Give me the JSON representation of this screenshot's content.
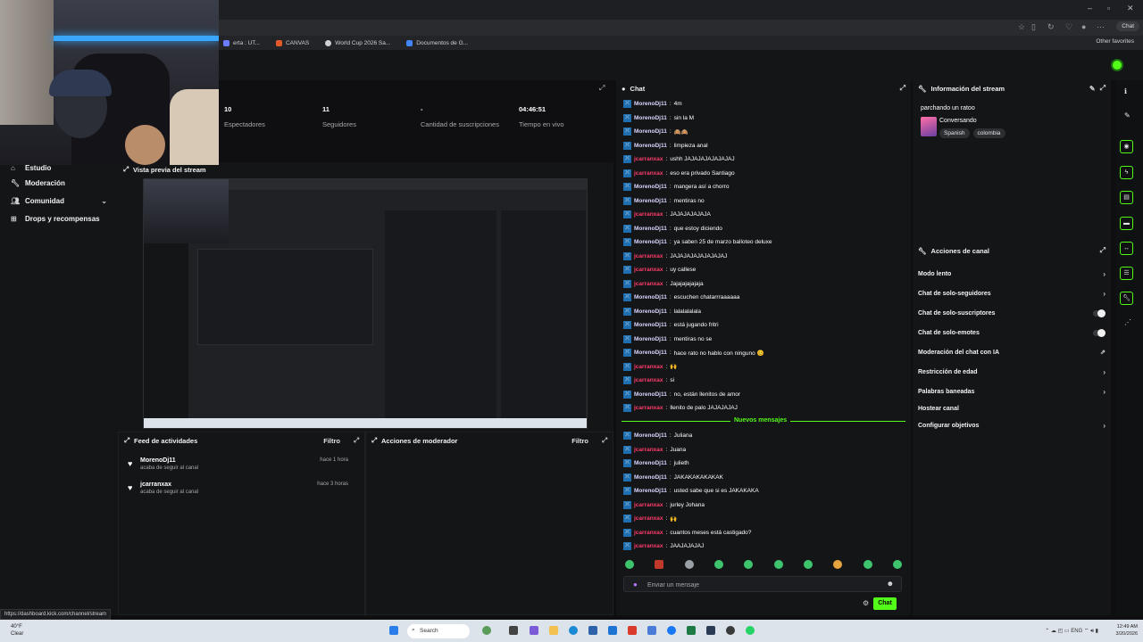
{
  "browser": {
    "bookmarks": [
      {
        "label": "erta : UT..."
      },
      {
        "label": "CANVAS"
      },
      {
        "label": "World Cup 2026 Sa..."
      },
      {
        "label": "Documentos de G..."
      }
    ],
    "other_favorites": "Other favorites",
    "chat_button": "Chat"
  },
  "sidebar": {
    "items": [
      {
        "label": "Estudio",
        "icon": "home-icon"
      },
      {
        "label": "Moderación",
        "icon": "wrench-icon"
      },
      {
        "label": "Comunidad",
        "icon": "people-icon"
      },
      {
        "label": "Drops y recompensas",
        "icon": "gift-icon"
      }
    ]
  },
  "stats": [
    {
      "value": "10",
      "label": "Espectadores"
    },
    {
      "value": "11",
      "label": "Seguidores"
    },
    {
      "value": "-",
      "label": "Cantidad de suscripciones"
    },
    {
      "value": "04:46:51",
      "label": "Tiempo en vivo"
    }
  ],
  "preview": {
    "title": "Vista previa del stream"
  },
  "activity": {
    "title": "Feed de actividades",
    "filter": "Filtro",
    "items": [
      {
        "name": "MorenoDj11",
        "sub": "acaba de seguir al canal",
        "time": "hace 1 hora"
      },
      {
        "name": "jcarranxax",
        "sub": "acaba de seguir al canal",
        "time": "hace 3 horas"
      }
    ]
  },
  "modactions": {
    "title": "Acciones de moderador",
    "filter": "Filtro"
  },
  "chat": {
    "title": "Chat",
    "messages": [
      {
        "user": "MorenoDj11",
        "kind": "a",
        "text": "4m"
      },
      {
        "user": "MorenoDj11",
        "kind": "a",
        "text": "sin la M"
      },
      {
        "user": "MorenoDj11",
        "kind": "a",
        "text": "🙈🙈"
      },
      {
        "user": "MorenoDj11",
        "kind": "a",
        "text": "limpieza anal"
      },
      {
        "user": "jcarranxax",
        "kind": "b",
        "text": "ushh JAJAJAJAJAJAJAJ"
      },
      {
        "user": "jcarranxax",
        "kind": "b",
        "text": "eso era privado Santiago"
      },
      {
        "user": "MorenoDj11",
        "kind": "a",
        "text": "mangera así a chorro"
      },
      {
        "user": "MorenoDj11",
        "kind": "a",
        "text": "mentiras no"
      },
      {
        "user": "jcarranxax",
        "kind": "b",
        "text": "JAJAJAJAJAJA"
      },
      {
        "user": "MorenoDj11",
        "kind": "a",
        "text": "que estoy diciendo"
      },
      {
        "user": "MorenoDj11",
        "kind": "a",
        "text": "ya saben 25 de marzo balloteo deluxe"
      },
      {
        "user": "jcarranxax",
        "kind": "b",
        "text": "JAJAJAJAJAJAJAJAJ"
      },
      {
        "user": "jcarranxax",
        "kind": "b",
        "text": "uy callese"
      },
      {
        "user": "jcarranxax",
        "kind": "b",
        "text": "Jajajajajajaja"
      },
      {
        "user": "MorenoDj11",
        "kind": "a",
        "text": "escuchen chatarrraaaaaa"
      },
      {
        "user": "MorenoDj11",
        "kind": "a",
        "text": "lalalalalala"
      },
      {
        "user": "MorenoDj11",
        "kind": "a",
        "text": "está jugando fritri"
      },
      {
        "user": "MorenoDj11",
        "kind": "a",
        "text": "mentiras no se"
      },
      {
        "user": "MorenoDj11",
        "kind": "a",
        "text": "hace rato no hablo con ninguno 😊"
      },
      {
        "user": "jcarranxax",
        "kind": "b",
        "text": "🙌"
      },
      {
        "user": "jcarranxax",
        "kind": "b",
        "text": "si"
      },
      {
        "user": "MorenoDj11",
        "kind": "a",
        "text": "no, están llenitos de amor"
      },
      {
        "user": "jcarranxax",
        "kind": "b",
        "text": "llenito de palo JAJAJAJAJ"
      }
    ],
    "new_messages_label": "Nuevos mensajes",
    "new_messages": [
      {
        "user": "MorenoDj11",
        "kind": "a",
        "text": "Juliana"
      },
      {
        "user": "jcarranxax",
        "kind": "b",
        "text": "Juana"
      },
      {
        "user": "MorenoDj11",
        "kind": "a",
        "text": "julieth"
      },
      {
        "user": "MorenoDj11",
        "kind": "a",
        "text": "JAKAKAKAKAKAK"
      },
      {
        "user": "MorenoDj11",
        "kind": "a",
        "text": "usted sabe que si es JAKAKAKA"
      },
      {
        "user": "jcarranxax",
        "kind": "b",
        "text": "jurley Johana"
      },
      {
        "user": "jcarranxax",
        "kind": "b",
        "text": "🙌"
      },
      {
        "user": "jcarranxax",
        "kind": "b",
        "text": "cuantos meses está castigado?"
      },
      {
        "user": "jcarranxax",
        "kind": "b",
        "text": "JAAJAJAJAJ"
      }
    ],
    "input_placeholder": "Enviar un mensaje",
    "send_label": "Chat"
  },
  "stream_info": {
    "title": "Información del stream",
    "stream_title": "parchando un ratoo",
    "category": "Conversando",
    "tags": [
      "Spanish",
      "colombia"
    ]
  },
  "channel_actions": {
    "title": "Acciones de canal",
    "items": [
      {
        "label": "Modo lento",
        "control": "chevron"
      },
      {
        "label": "Chat de solo-seguidores",
        "control": "chevron"
      },
      {
        "label": "Chat de solo-suscriptores",
        "control": "toggle"
      },
      {
        "label": "Chat de solo-emotes",
        "control": "toggle"
      },
      {
        "label": "Moderación del chat con IA",
        "control": "external"
      },
      {
        "label": "Restricción de edad",
        "control": "chevron"
      },
      {
        "label": "Palabras baneadas",
        "control": "chevron"
      },
      {
        "label": "Hostear canal",
        "control": "none"
      },
      {
        "label": "Configurar objetivos",
        "control": "chevron"
      }
    ]
  },
  "statusbar": {
    "url": "https://dashboard.kick.com/channel/stream"
  },
  "taskbar": {
    "weather_temp": "40°F",
    "weather_desc": "Clear",
    "search": "Search",
    "lang": "ENG",
    "time": "12:49 AM",
    "date": "3/20/2026"
  }
}
